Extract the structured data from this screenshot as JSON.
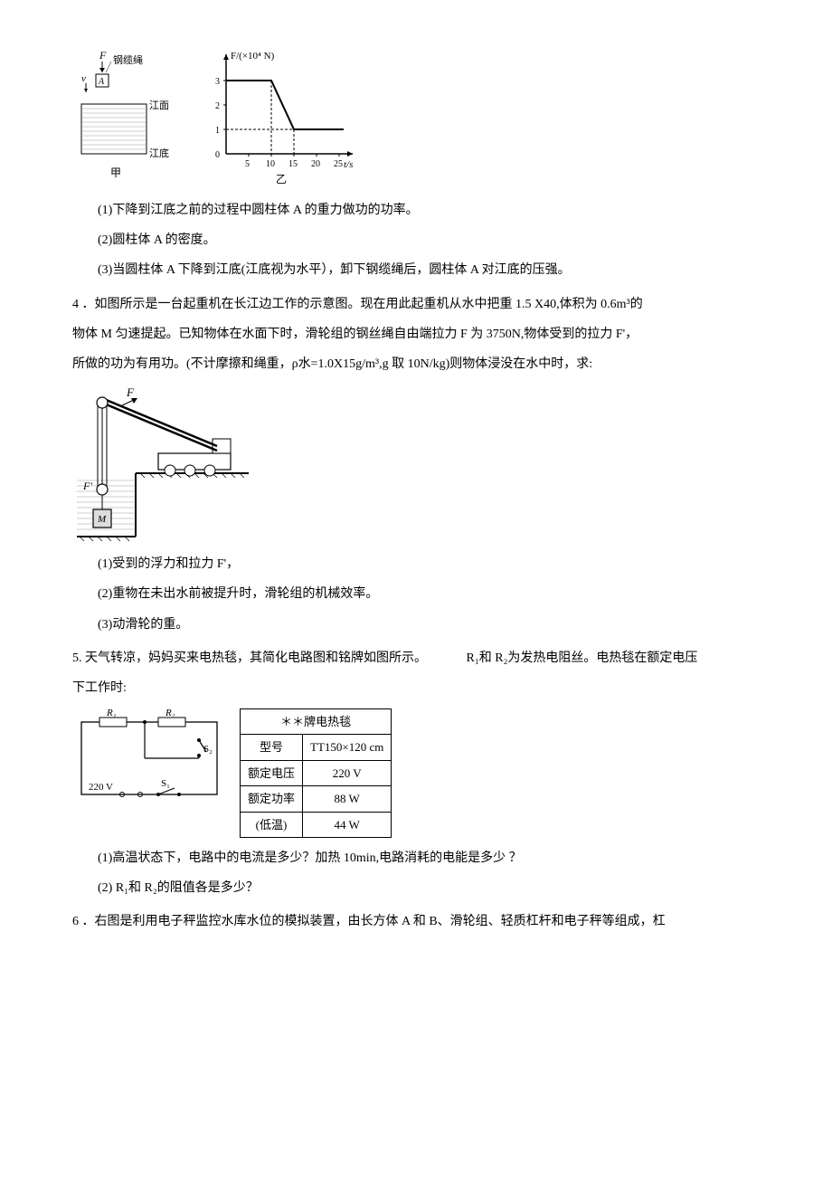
{
  "fig1": {
    "label_cable": "钢缆绳",
    "label_surface": "江面",
    "label_bottom": "江底",
    "caption": "甲",
    "force_label": "F",
    "vel_label": "v",
    "block_label": "A"
  },
  "chart_data": {
    "type": "line",
    "title": "",
    "xlabel": "t/s",
    "ylabel": "F/(×10⁴ N)",
    "x": [
      0,
      5,
      10,
      15,
      20,
      25
    ],
    "y_ticks": [
      0,
      1,
      2,
      3
    ],
    "series": [
      {
        "name": "F",
        "points": [
          [
            0,
            3
          ],
          [
            10,
            3
          ],
          [
            15,
            1
          ],
          [
            25,
            1
          ]
        ]
      }
    ],
    "xlim": [
      0,
      25
    ],
    "ylim": [
      0,
      3
    ],
    "caption": "乙"
  },
  "q_sub": {
    "s1": "(1)下降到江底之前的过程中圆柱体 A 的重力做功的功率。",
    "s2": "(2)圆柱体 A 的密度。",
    "s3": "(3)当圆柱体 A 下降到江底(江底视为水平），卸下钢缆绳后，圆柱体 A 对江底的压强。"
  },
  "q4": {
    "line1": "4 ．如图所示是一台起重机在长江边工作的示意图。现在用此起重机从水中把重 1.5 X40,体积为 0.6m³的",
    "line2": "物体 M 匀速提起。已知物体在水面下时，滑轮组的钢丝绳自由端拉力 F 为 3750N,物体受到的拉力 F'，",
    "line3": "所做的功为有用功。(不计摩擦和绳重，ρ水=1.0X15g/m³,g 取 10N/kg)则物体浸没在水中时，求:",
    "s1": "(1)受到的浮力和拉力 F'，",
    "s2": "(2)重物在未出水前被提升时，滑轮组的机械效率。",
    "s3": "(3)动滑轮的重。"
  },
  "fig4": {
    "force_top": "F",
    "force_bottom": "F'",
    "block": "M"
  },
  "q5": {
    "line1a": "5. 天气转凉，妈妈买来电热毯，其简化电路图和铭牌如图所示。",
    "line1b": "R₁和 R₂为发热电阻丝。电热毯在额定电压",
    "line2": "下工作时:",
    "s1": "(1)高温状态下，电路中的电流是多少？加热 10min,电路消耗的电能是多少 ？",
    "s2": "(2) R₁和 R₂的阻值各是多少？"
  },
  "circuit": {
    "r1": "R₁",
    "r2": "R₂",
    "s1": "S₁",
    "s2": "S₂",
    "voltage": "220 V"
  },
  "nameplate": {
    "title": "＊＊牌电热毯",
    "rows": [
      {
        "label": "型号",
        "value": "TT150×120 cm"
      },
      {
        "label": "额定电压",
        "value": "220 V"
      },
      {
        "label": "额定功率",
        "value": "88 W"
      },
      {
        "label": "(低温)",
        "value": "44 W"
      }
    ]
  },
  "q6": {
    "line1": "6 ．右图是利用电子秤监控水库水位的模拟装置，由长方体 A 和 B、滑轮组、轻质杠杆和电子秤等组成，杠"
  }
}
